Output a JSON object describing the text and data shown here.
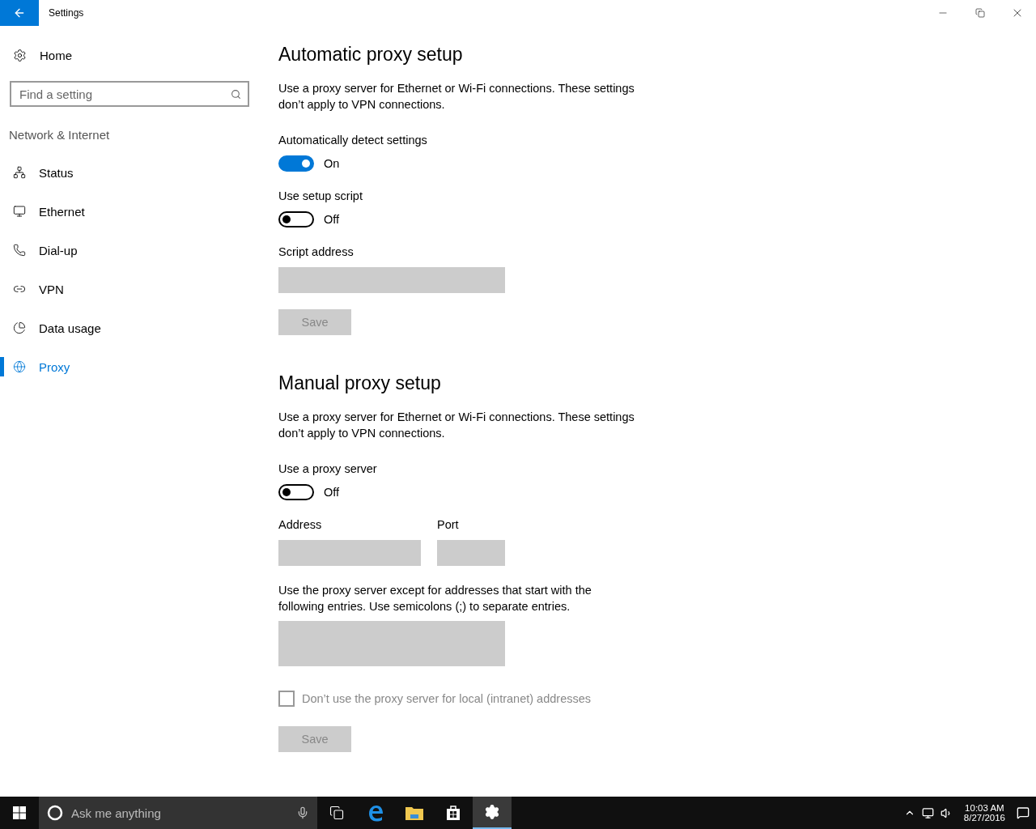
{
  "window": {
    "title": "Settings"
  },
  "sidebar": {
    "home": "Home",
    "search": {
      "placeholder": "Find a setting"
    },
    "section": "Network & Internet",
    "items": [
      {
        "label": "Status",
        "selected": false
      },
      {
        "label": "Ethernet",
        "selected": false
      },
      {
        "label": "Dial-up",
        "selected": false
      },
      {
        "label": "VPN",
        "selected": false
      },
      {
        "label": "Data usage",
        "selected": false
      },
      {
        "label": "Proxy",
        "selected": true
      }
    ]
  },
  "automatic": {
    "heading": "Automatic proxy setup",
    "description": "Use a proxy server for Ethernet or Wi-Fi connections. These settings don’t apply to VPN connections.",
    "toggles": [
      {
        "label": "Automatically detect settings",
        "on": true,
        "state_text": "On"
      },
      {
        "label": "Use setup script",
        "on": false,
        "state_text": "Off"
      }
    ],
    "script_label": "Script address",
    "script_disabled": true,
    "save": {
      "label": "Save",
      "disabled": true
    }
  },
  "manual": {
    "heading": "Manual proxy setup",
    "description": "Use a proxy server for Ethernet or Wi-Fi connections. These settings don’t apply to VPN connections.",
    "toggle": {
      "label": "Use a proxy server",
      "on": false,
      "state_text": "Off"
    },
    "address_label": "Address",
    "port_label": "Port",
    "fields_disabled": true,
    "exceptions_label": "Use the proxy server except for addresses that start with the following entries. Use semicolons (;) to separate entries.",
    "local_checkbox": {
      "label": "Don’t use the proxy server for local (intranet) addresses",
      "checked": false,
      "disabled": true
    },
    "save": {
      "label": "Save",
      "disabled": true
    }
  },
  "taskbar": {
    "search": {
      "placeholder": "Ask me anything"
    },
    "time": "10:03 AM",
    "date": "8/27/2016"
  }
}
